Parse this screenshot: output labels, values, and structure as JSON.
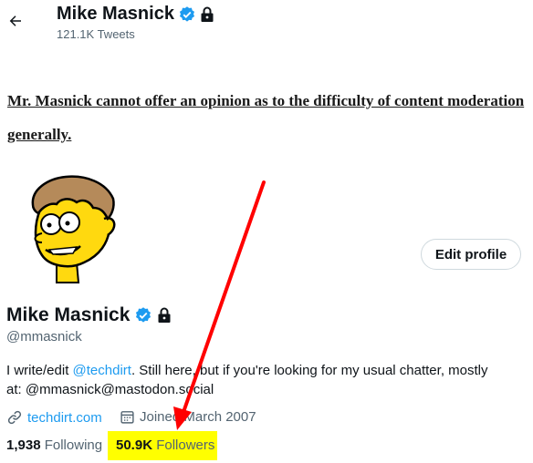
{
  "header": {
    "title": "Mike Masnick",
    "tweet_count": "121.1K Tweets"
  },
  "banner": {
    "line1": "Mr. Masnick cannot offer an opinion as to the difficulty of content moderation",
    "line2": "generally."
  },
  "profile": {
    "edit_label": "Edit profile",
    "name": "Mike Masnick",
    "handle": "@mmasnick",
    "bio_prefix": "I write/edit ",
    "bio_mention": "@techdirt",
    "bio_line1_suffix": ". Still here, but if you're looking for my usual chatter, mostly",
    "bio_line2": "at: @mmasnick@mastodon.social",
    "website": "techdirt.com",
    "joined": "Joined March 2007",
    "following_count": "1,938",
    "following_label": "Following",
    "followers_count": "50.9K",
    "followers_label": "Followers"
  },
  "colors": {
    "verified": "#1d9bf0",
    "link": "#1d9bf0",
    "highlight": "#ffff00",
    "arrow": "#ff0000"
  },
  "icons": [
    "back-arrow-icon",
    "verified-badge-icon",
    "lock-icon",
    "link-icon",
    "calendar-icon"
  ]
}
